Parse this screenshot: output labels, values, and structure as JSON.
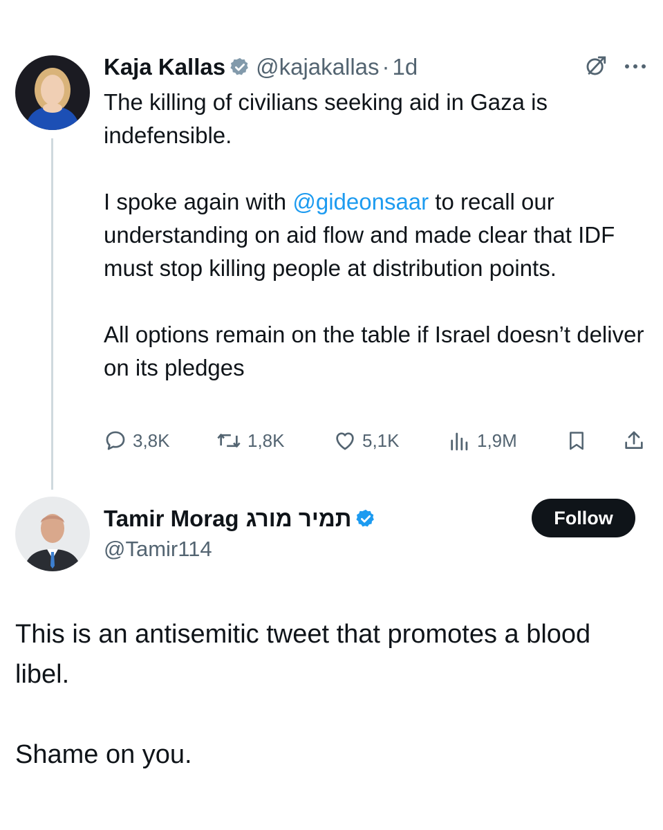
{
  "tweet": {
    "author_name": "Kaja Kallas",
    "verified_badge_icon": "gray-verified-badge-icon",
    "handle": "@kajakallas",
    "separator": "·",
    "time": "1d",
    "text_line_1": "The killing of civilians seeking aid in Gaza is indefensible.",
    "text_p2_before": "I spoke again with ",
    "text_p2_mention": "@gideonsaar",
    "text_p2_after": " to recall our understanding on aid flow and made clear that IDF must stop killing people at distribution points.",
    "text_p3": "All options remain on the table if Israel doesn’t deliver on its pledges",
    "stats": {
      "replies": "3,8K",
      "reposts": "1,8K",
      "likes": "5,1K",
      "views": "1,9M"
    }
  },
  "reply": {
    "author_name": "Tamir Morag",
    "author_name_hebrew": "תמיר מורג",
    "verified_badge_icon": "blue-verified-badge-icon",
    "handle": "@Tamir114",
    "follow_label": "Follow",
    "text_p1": "This is an antisemitic tweet that promotes a blood libel.",
    "text_p2": "Shame on you."
  },
  "colors": {
    "accent_blue": "#1d9bf0",
    "text_primary": "#0f1419",
    "text_secondary": "#536471",
    "thread_line": "#cfd9de",
    "gov_badge": "#829aab",
    "follow_bg": "#0f1419"
  }
}
